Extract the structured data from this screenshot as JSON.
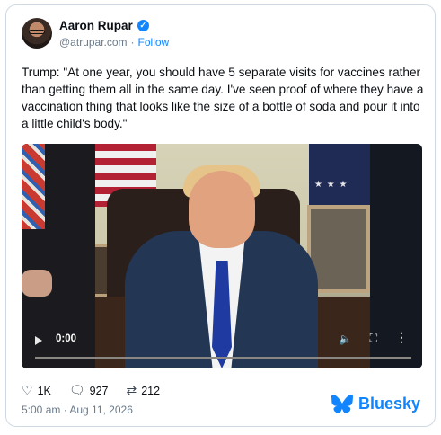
{
  "author": {
    "name": "Aaron Rupar",
    "handle": "@atrupar.com",
    "separator": "·",
    "follow_label": "Follow"
  },
  "post": {
    "text": "Trump: \"At one year, you should have 5 separate visits for vaccines rather than getting them all in the same day. I've seen proof of where they have a vaccination thing that looks like the size of a bottle of soda and pour it into a little child's body.\"",
    "timestamp": "5:00 am · Aug 11, 2026"
  },
  "video": {
    "time": "0:00",
    "icons": [
      "play-icon",
      "volume-icon",
      "fullscreen-icon",
      "more-icon"
    ]
  },
  "engagement": {
    "likes": "1K",
    "replies": "927",
    "reposts": "212"
  },
  "brand": {
    "name": "Bluesky",
    "color": "#1185fe"
  }
}
